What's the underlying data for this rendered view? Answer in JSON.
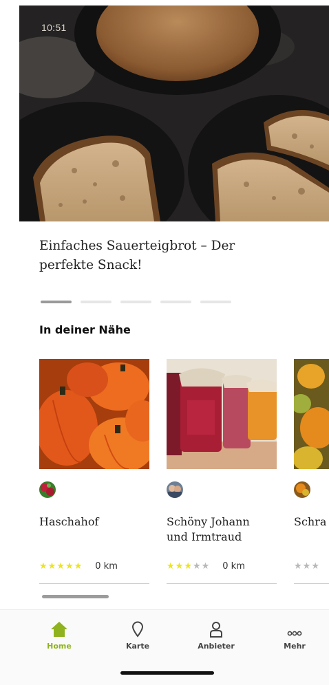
{
  "status_bar": {
    "time": "10:51"
  },
  "featured": {
    "title_line1": "Einfaches Sauerteigbrot – Der",
    "title_line2": "perfekte Snack!",
    "pager_count": 5,
    "pager_active_index": 0
  },
  "nearby": {
    "section_title": "In deiner Nähe",
    "cards": [
      {
        "name_line1": "Haschahof",
        "name_line2": "",
        "rating": 5,
        "max_rating": 5,
        "distance": "0 km"
      },
      {
        "name_line1": "Schöny Johann",
        "name_line2": "und Irmtraud",
        "rating": 3,
        "max_rating": 5,
        "distance": "0 km"
      },
      {
        "name_line1": "Schra",
        "name_line2": "",
        "rating": 3,
        "max_rating": 5,
        "distance": ""
      }
    ]
  },
  "tabbar": {
    "items": [
      {
        "label": "Home",
        "icon": "home-icon",
        "active": true
      },
      {
        "label": "Karte",
        "icon": "map-pin-icon",
        "active": false
      },
      {
        "label": "Anbieter",
        "icon": "person-icon",
        "active": false
      },
      {
        "label": "Mehr",
        "icon": "more-dots-icon",
        "active": false
      }
    ]
  },
  "colors": {
    "accent_green": "#8fb31e",
    "star_yellow": "#ece41e",
    "star_grey": "#b8b8b8"
  }
}
